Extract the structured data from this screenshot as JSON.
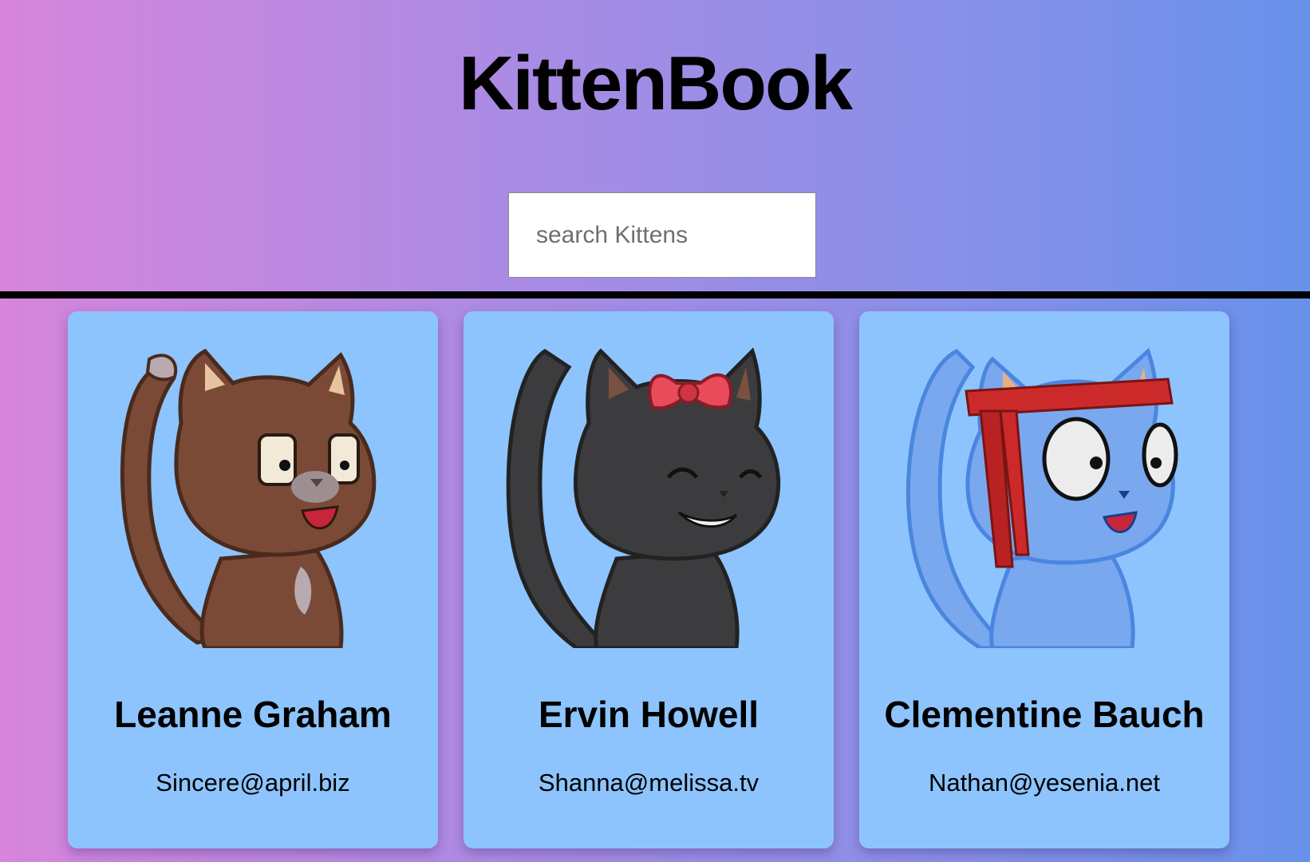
{
  "header": {
    "title": "KittenBook",
    "search_placeholder": "search Kittens",
    "search_value": ""
  },
  "kittens": [
    {
      "name": "Leanne Graham",
      "email": "Sincere@april.biz",
      "icon": "brown-kitten-icon",
      "color": "#7a4a36"
    },
    {
      "name": "Ervin Howell",
      "email": "Shanna@melissa.tv",
      "icon": "black-kitten-with-bow-icon",
      "color": "#3c3c3e"
    },
    {
      "name": "Clementine Bauch",
      "email": "Nathan@yesenia.net",
      "icon": "blue-kitten-with-headband-icon",
      "color": "#79a8ef"
    }
  ],
  "colors": {
    "gradient_start": "#d685db",
    "gradient_end": "#6791ea",
    "card_background": "#8dc4fd"
  }
}
